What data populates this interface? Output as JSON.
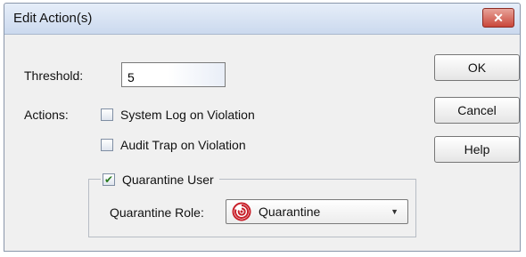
{
  "window": {
    "title": "Edit Action(s)",
    "close_glyph": "✕"
  },
  "threshold": {
    "label": "Threshold:",
    "value": "5"
  },
  "actions": {
    "label": "Actions:",
    "items": [
      {
        "label": "System Log on Violation",
        "checked": false
      },
      {
        "label": "Audit Trap on Violation",
        "checked": false
      },
      {
        "label": "Quarantine User",
        "checked": true
      }
    ]
  },
  "quarantine": {
    "role_label": "Quarantine Role:",
    "role_value": "Quarantine",
    "role_icon": "quarantine-role-icon",
    "dropdown_glyph": "▼"
  },
  "buttons": {
    "ok": "OK",
    "cancel": "Cancel",
    "help": "Help"
  }
}
